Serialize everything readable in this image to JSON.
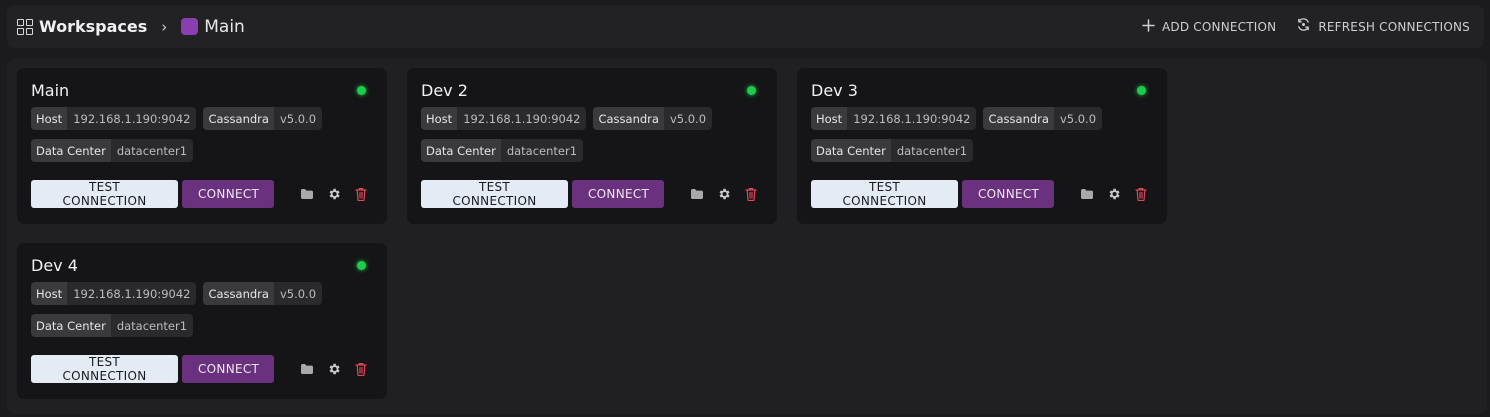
{
  "breadcrumb": {
    "root": "Workspaces",
    "separator": "›",
    "current": "Main",
    "current_color": "#8a3fb0"
  },
  "header_actions": {
    "add_label": "ADD CONNECTION",
    "add_icon": "plus-icon",
    "refresh_label": "REFRESH CONNECTIONS",
    "refresh_icon": "refresh-icon"
  },
  "connections": [
    {
      "name": "Main",
      "status": "connected",
      "status_color": "#1ccd4a",
      "host_key": "Host",
      "host": "192.168.1.190:9042",
      "db": "Cassandra",
      "version": "v5.0.0",
      "dc_key": "Data Center",
      "dc": "datacenter1",
      "test_label": "TEST CONNECTION",
      "connect_label": "CONNECT"
    },
    {
      "name": "Dev 2",
      "status": "connected",
      "status_color": "#1ccd4a",
      "host_key": "Host",
      "host": "192.168.1.190:9042",
      "db": "Cassandra",
      "version": "v5.0.0",
      "dc_key": "Data Center",
      "dc": "datacenter1",
      "test_label": "TEST CONNECTION",
      "connect_label": "CONNECT"
    },
    {
      "name": "Dev 3",
      "status": "connected",
      "status_color": "#1ccd4a",
      "host_key": "Host",
      "host": "192.168.1.190:9042",
      "db": "Cassandra",
      "version": "v5.0.0",
      "dc_key": "Data Center",
      "dc": "datacenter1",
      "test_label": "TEST CONNECTION",
      "connect_label": "CONNECT"
    },
    {
      "name": "Dev 4",
      "status": "connected",
      "status_color": "#1ccd4a",
      "host_key": "Host",
      "host": "192.168.1.190:9042",
      "db": "Cassandra",
      "version": "v5.0.0",
      "dc_key": "Data Center",
      "dc": "datacenter1",
      "test_label": "TEST CONNECTION",
      "connect_label": "CONNECT"
    }
  ],
  "card_icons": [
    "folder-icon",
    "gear-icon",
    "trash-icon"
  ],
  "colors": {
    "accent": "#6a317e",
    "danger": "#e0465a",
    "test_button": "#e4ebf5"
  }
}
